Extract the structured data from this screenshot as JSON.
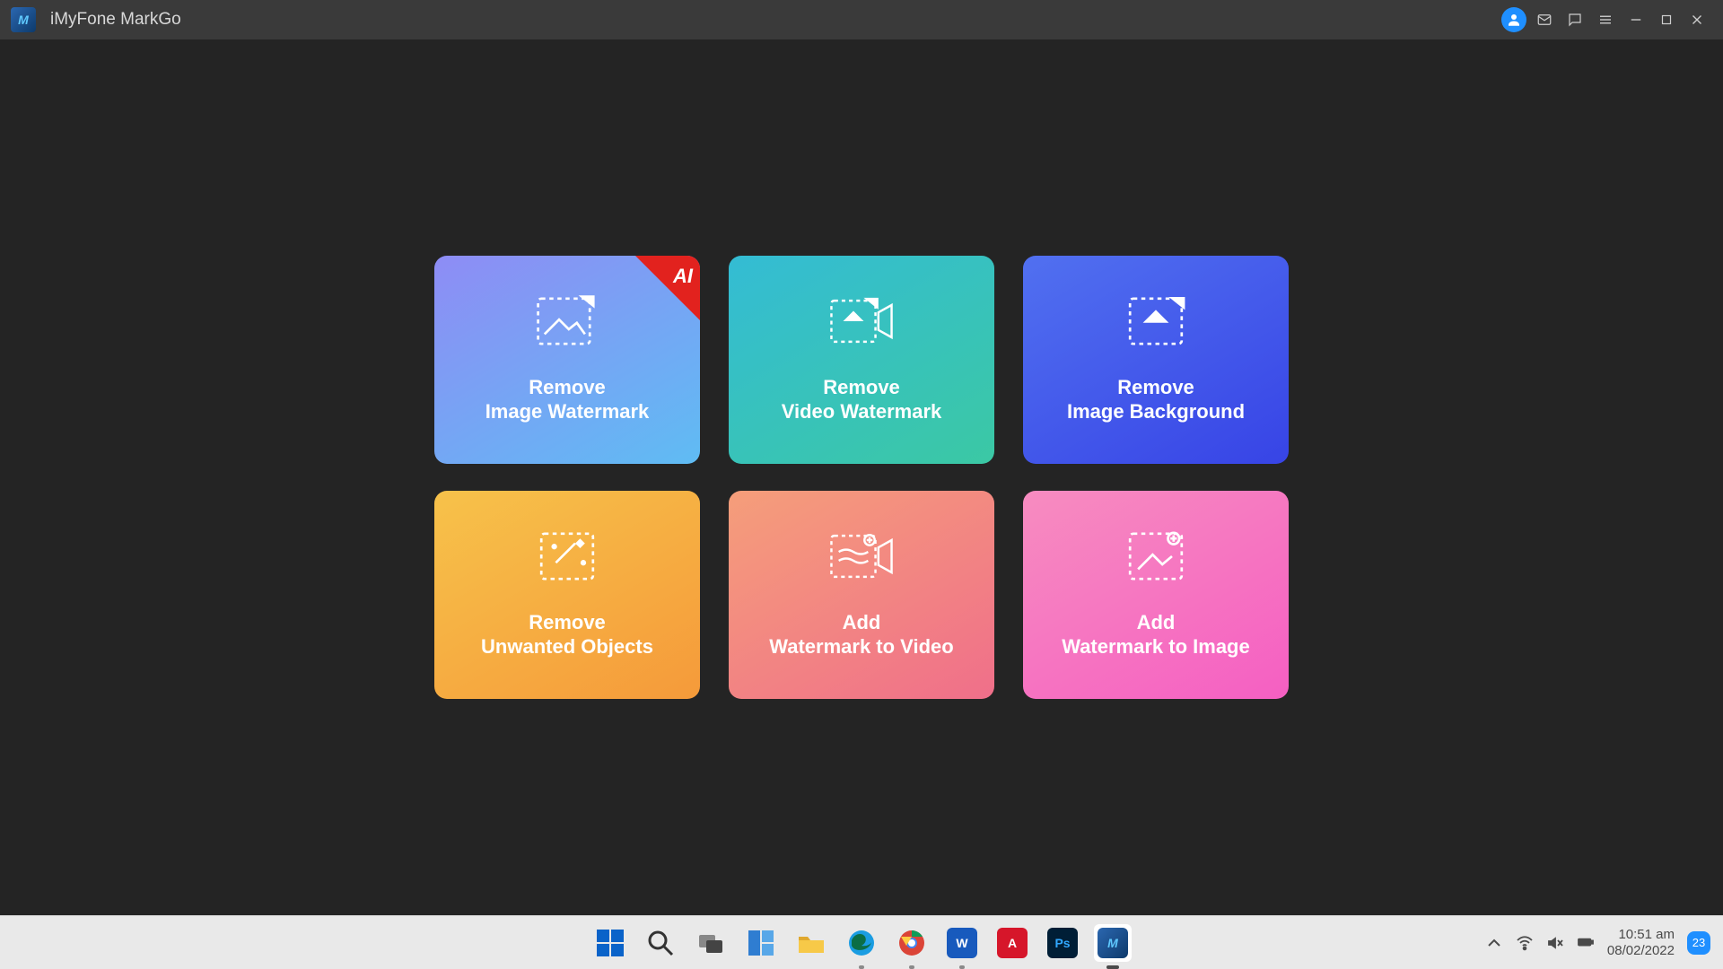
{
  "window": {
    "title": "iMyFone MarkGo"
  },
  "tiles": [
    {
      "line1": "Remove",
      "line2": "Image Watermark",
      "ai_badge": "AI"
    },
    {
      "line1": "Remove",
      "line2": "Video Watermark"
    },
    {
      "line1": "Remove",
      "line2": "Image Background"
    },
    {
      "line1": "Remove",
      "line2": "Unwanted Objects"
    },
    {
      "line1": "Add",
      "line2": "Watermark to Video"
    },
    {
      "line1": "Add",
      "line2": "Watermark to Image"
    }
  ],
  "taskbar": {
    "time": "10:51 am",
    "date": "08/02/2022",
    "notification_count": "23"
  }
}
